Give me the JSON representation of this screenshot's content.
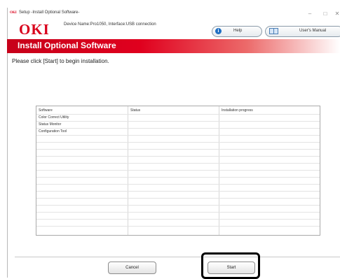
{
  "window": {
    "title": "Setup -Install Optional Software-",
    "app_icon": "OKI",
    "minimize": "–",
    "maximize": "□",
    "close": "✕"
  },
  "brand": {
    "logo": "OKI",
    "device_info": "Device Name:Pro1050, Interface:USB connection"
  },
  "toolbar": {
    "help_label": "Help",
    "help_icon": "i",
    "manual_label": "User's Manual"
  },
  "banner": {
    "title": "Install Optional Software"
  },
  "instruction": "Please click [Start] to begin installation.",
  "table": {
    "columns": [
      "Software",
      "Status",
      "Installation progress"
    ],
    "rows": [
      [
        "Color Correct Utility",
        "",
        ""
      ],
      [
        "Status Monitor",
        "",
        ""
      ],
      [
        "Configuration Tool",
        "",
        ""
      ]
    ]
  },
  "buttons": {
    "cancel": "Cancel",
    "start": "Start"
  },
  "colors": {
    "accent": "#d9001b",
    "highlight_border": "#000000"
  }
}
